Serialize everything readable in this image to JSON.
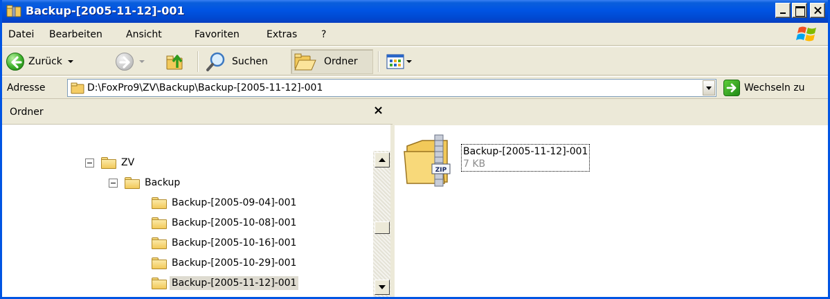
{
  "window": {
    "title": "Backup-[2005-11-12]-001"
  },
  "menu": {
    "items": [
      "Datei",
      "Bearbeiten",
      "Ansicht",
      "Favoriten",
      "Extras",
      "?"
    ]
  },
  "toolbar": {
    "back_label": "Zurück",
    "search_label": "Suchen",
    "folders_label": "Ordner"
  },
  "address": {
    "label": "Adresse",
    "value": "D:\\FoxPro9\\ZV\\Backup\\Backup-[2005-11-12]-001",
    "go_label": "Wechseln zu"
  },
  "tree": {
    "header": "Ordner",
    "close_glyph": "×",
    "items": [
      {
        "label": "ZV",
        "level": 0,
        "expanded": true
      },
      {
        "label": "Backup",
        "level": 1,
        "expanded": true
      },
      {
        "label": "Backup-[2005-09-04]-001",
        "level": 2
      },
      {
        "label": "Backup-[2005-10-08]-001",
        "level": 2
      },
      {
        "label": "Backup-[2005-10-16]-001",
        "level": 2
      },
      {
        "label": "Backup-[2005-10-29]-001",
        "level": 2
      },
      {
        "label": "Backup-[2005-11-12]-001",
        "level": 2,
        "selected": true
      }
    ]
  },
  "content": {
    "files": [
      {
        "name": "Backup-[2005-11-12]-001",
        "size": "7 KB",
        "type_badge": "ZIP",
        "icon": "zip-folder-icon"
      }
    ]
  },
  "colors": {
    "titlebar": "#0054e3",
    "chrome": "#ece9d8",
    "accent_green": "#3cb02a"
  }
}
